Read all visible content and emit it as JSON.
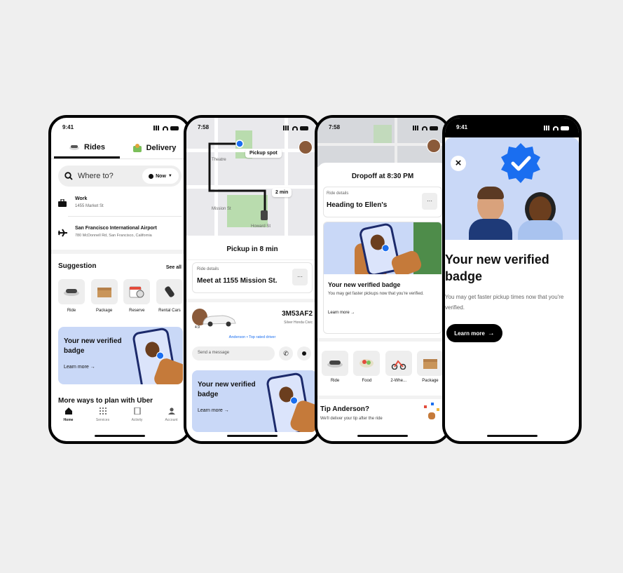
{
  "phone1": {
    "time": "9:41",
    "tabs": [
      {
        "label": "Rides"
      },
      {
        "label": "Delivery"
      }
    ],
    "search": {
      "placeholder": "Where to?",
      "time_label": "Now"
    },
    "places": [
      {
        "title": "Work",
        "subtitle": "1455 Market St"
      },
      {
        "title": "San Francisco International Airport",
        "subtitle": "780 McDonnell Rd, San Francisco, California"
      }
    ],
    "suggestion_title": "Suggestion",
    "see_all": "See all",
    "suggestions": [
      {
        "label": "Ride"
      },
      {
        "label": "Package"
      },
      {
        "label": "Reserve"
      },
      {
        "label": "Rental Cars"
      }
    ],
    "promo": {
      "title": "Your new verified badge",
      "cta": "Learn more →"
    },
    "more_ways": "More ways to plan with Uber",
    "nav": [
      {
        "label": "Home"
      },
      {
        "label": "Services"
      },
      {
        "label": "Activity"
      },
      {
        "label": "Account"
      }
    ]
  },
  "phone2": {
    "time": "7:58",
    "map_labels": {
      "pickup": "Pickup spot",
      "eta": "2 min",
      "street1": "Mission St",
      "street2": "Howard St",
      "place": "Theatre"
    },
    "pickup_title": "Pickup in 8 min",
    "ride_details_label": "Ride details",
    "ride_details_value": "Meet at 1155 Mission St.",
    "more": "···",
    "plate": "3M53AF2",
    "car_desc": "Silver Honda Civic",
    "rating": "4.9",
    "driver_line": "Anderson • Top rated driver",
    "message_placeholder": "Send a message",
    "promo": {
      "title": "Your new verified badge",
      "cta": "Learn more →"
    }
  },
  "phone3": {
    "time": "7:58",
    "dropoff_title": "Dropoff at 8:30 PM",
    "ride_details_label": "Ride details",
    "ride_details_value": "Heading to Ellen's",
    "more": "···",
    "promo": {
      "title": "Your new verified badge",
      "body": "You may get faster pickups now that you're verified.",
      "cta": "Learn more →"
    },
    "services": [
      {
        "label": "Ride"
      },
      {
        "label": "Food"
      },
      {
        "label": "2-Whe..."
      },
      {
        "label": "Package"
      }
    ],
    "tip_title": "Tip Anderson?",
    "tip_sub": "We'll deliver your tip after the ride"
  },
  "phone4": {
    "time": "9:41",
    "close": "×",
    "title": "Your new verified badge",
    "body": "You may get faster pickup times now that you're verified.",
    "cta": "Learn more"
  },
  "colors": {
    "accent_blue": "#1a6ef0",
    "promo_bg": "#c9d8f7",
    "black": "#000000"
  }
}
